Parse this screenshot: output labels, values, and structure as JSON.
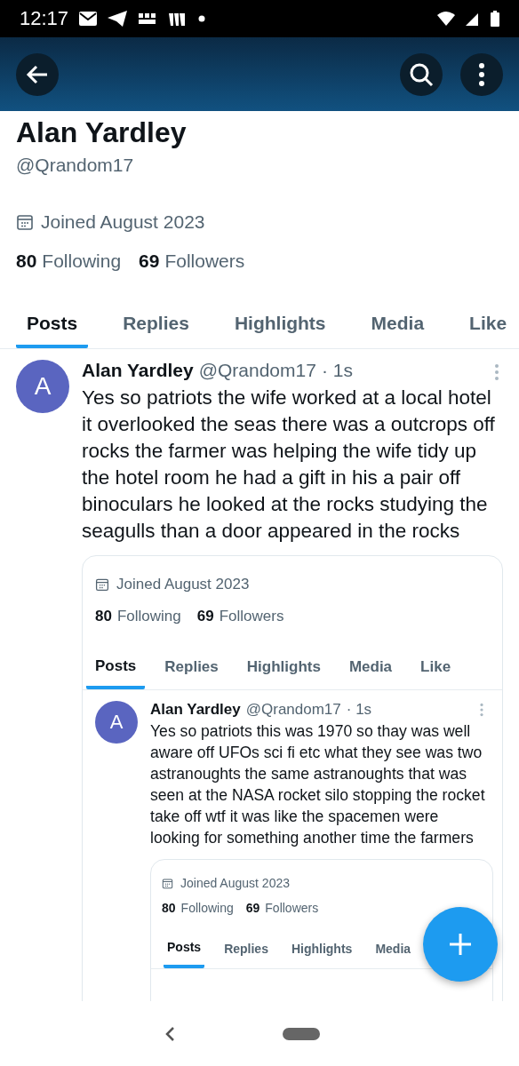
{
  "status_bar": {
    "time": "12:17"
  },
  "profile": {
    "name": "Alan Yardley",
    "handle": "@Qrandom17",
    "joined": "Joined August 2023",
    "following_count": "80",
    "following_label": "Following",
    "followers_count": "69",
    "followers_label": "Followers"
  },
  "tabs": [
    {
      "label": "Posts",
      "selected": true
    },
    {
      "label": "Replies",
      "selected": false
    },
    {
      "label": "Highlights",
      "selected": false
    },
    {
      "label": "Media",
      "selected": false
    },
    {
      "label": "Like",
      "selected": false
    }
  ],
  "post": {
    "avatar_letter": "A",
    "author": "Alan Yardley",
    "handle": "@Qrandom17",
    "time": "· 1s",
    "text": "Yes so patriots the wife worked at a local hotel it overlooked the seas there was a outcrops off rocks  the farmer was helping the wife tidy up the hotel room he had a gift in his a pair off binoculars he looked at the rocks studying the seagulls than a door appeared in the rocks",
    "embed": {
      "joined": "Joined August 2023",
      "following_count": "80",
      "following_label": "Following",
      "followers_count": "69",
      "followers_label": "Followers",
      "tabs": [
        {
          "label": "Posts",
          "selected": true
        },
        {
          "label": "Replies",
          "selected": false
        },
        {
          "label": "Highlights",
          "selected": false
        },
        {
          "label": "Media",
          "selected": false
        },
        {
          "label": "Like",
          "selected": false
        }
      ],
      "post": {
        "avatar_letter": "A",
        "author": "Alan Yardley",
        "handle": "@Qrandom17",
        "time": "· 1s",
        "text": "Yes so patriots this was 1970 so thay was well aware off UFOs sci fi etc  what they see was two astranoughts the same astranoughts that was seen at the NASA rocket silo stopping the rocket take off wtf it was like the spacemen were looking for something another time the farmers",
        "embed": {
          "joined": "Joined August 2023",
          "following_count": "80",
          "following_label": "Following",
          "followers_count": "69",
          "followers_label": "Followers",
          "tabs": [
            {
              "label": "Posts",
              "selected": true
            },
            {
              "label": "Replies",
              "selected": false
            },
            {
              "label": "Highlights",
              "selected": false
            },
            {
              "label": "Media",
              "selected": false
            }
          ]
        }
      }
    }
  }
}
